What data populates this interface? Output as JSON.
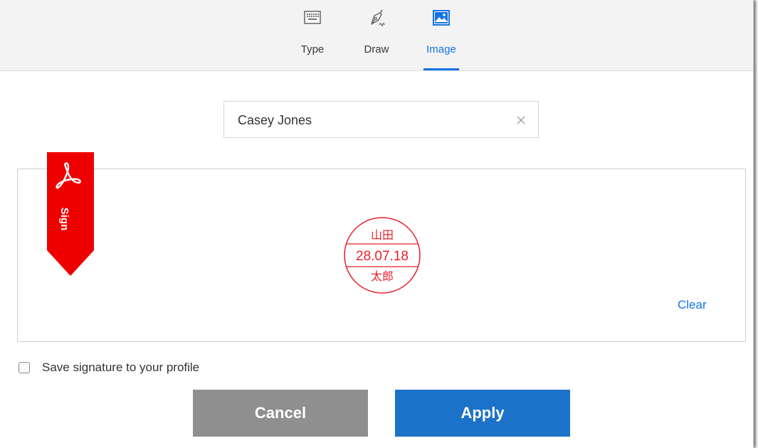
{
  "tabs": [
    {
      "label": "Type",
      "icon": "keyboard-icon",
      "active": false
    },
    {
      "label": "Draw",
      "icon": "pen-icon",
      "active": false
    },
    {
      "label": "Image",
      "icon": "image-icon",
      "active": true
    }
  ],
  "name_input": {
    "value": "Casey Jones"
  },
  "ribbon": {
    "label": "Sign"
  },
  "stamp": {
    "top_text": "山田",
    "date": "28.07.18",
    "bottom_text": "太郎"
  },
  "clear_label": "Clear",
  "save_signature": {
    "label": "Save signature to your profile",
    "checked": false
  },
  "buttons": {
    "cancel": "Cancel",
    "apply": "Apply"
  },
  "colors": {
    "accent": "#1473e6",
    "apply_button": "#1c72c8",
    "cancel_button": "#8f8f8f",
    "ribbon_red": "#ee0000",
    "stamp_red": "#e8202a"
  }
}
